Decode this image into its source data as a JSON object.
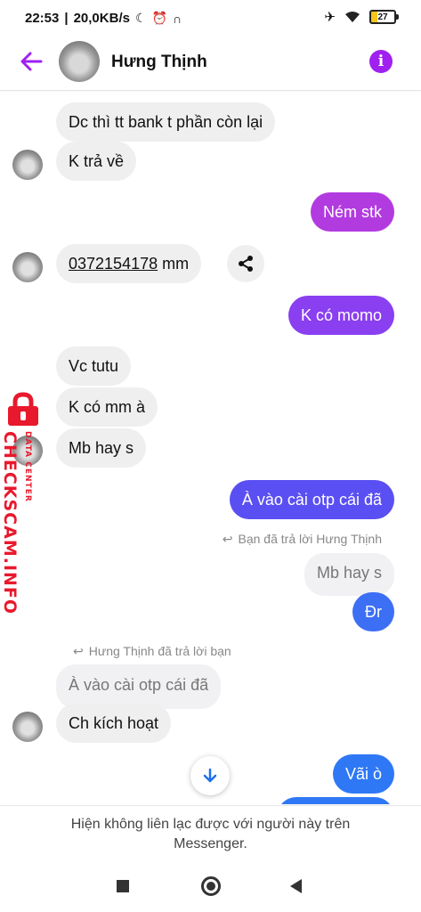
{
  "status_bar": {
    "time": "22:53",
    "speed": "20,0KB/s",
    "battery": "27",
    "icons": [
      "moon-icon",
      "alarm-icon",
      "headphones-icon",
      "airplane-icon",
      "wifi-icon"
    ]
  },
  "header": {
    "contact_name": "Hưng Thịnh",
    "accent_color": "#a020f0"
  },
  "messages": [
    {
      "side": "in",
      "text": "Dc thì tt bank t phần còn lại"
    },
    {
      "side": "in",
      "text": "K trả về"
    },
    {
      "side": "out",
      "text": "Ném stk"
    },
    {
      "side": "in",
      "text": "0372154178",
      "suffix": " mm"
    },
    {
      "side": "out",
      "text": "K có momo"
    },
    {
      "side": "in",
      "text": "Vc tutu"
    },
    {
      "side": "in",
      "text": "K có mm à"
    },
    {
      "side": "in",
      "text": "Mb hay s"
    },
    {
      "side": "out",
      "text": "À vào cài otp cái đã"
    },
    {
      "side": "note",
      "text": "Bạn đã trả lời Hưng Thịnh"
    },
    {
      "side": "quoted",
      "text": "Mb hay s"
    },
    {
      "side": "out",
      "text": "Đr"
    },
    {
      "side": "note",
      "text": "Hưng Thịnh đã trả lời bạn"
    },
    {
      "side": "quoted",
      "text": "À vào cài otp cái đã"
    },
    {
      "side": "in",
      "text": "Ch kích hoạt"
    },
    {
      "side": "out",
      "text": "Vãi ò"
    }
  ],
  "bubble_colors": {
    "out_top": "#b23be0",
    "out_mid": "#7b3ff0",
    "out_bottom": "#3d6ff5"
  },
  "watermark": {
    "main": "CHECKSCAM.INFO",
    "sub": "DATA CENTER"
  },
  "footer": {
    "notice": "Hiện không liên lạc được với người này trên Messenger."
  }
}
